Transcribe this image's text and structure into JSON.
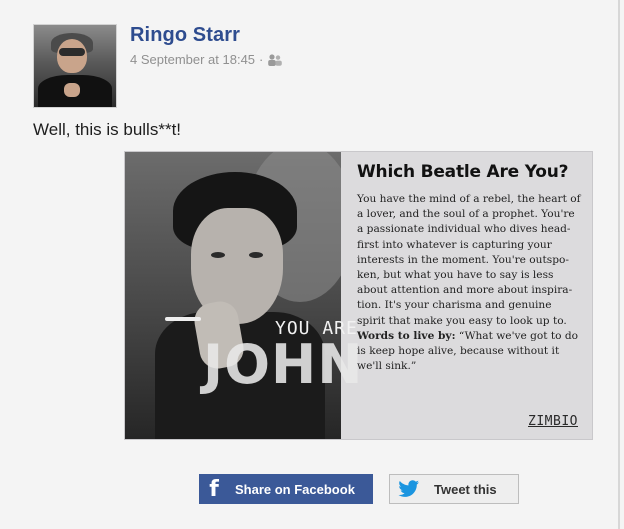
{
  "post": {
    "author": "Ringo Starr",
    "timestamp": "4 September at 18:45",
    "separator": "·",
    "audience_icon": "friends-icon",
    "text": "Well, this is bulls**t!"
  },
  "card": {
    "overlay_you_are": "YOU ARE",
    "overlay_name": "JOHN",
    "title": "Which Beatle Are You?",
    "body": "You have the mind of a rebel, the heart of a lover, and the soul of a prophet. You're a passionate individual who dives head-first into whatever is capturing your interests in the moment. You're outspo-ken, but what you have to say is less about attention and more about inspira-tion. It's your charisma and genuine spirit that make you easy to look up to.",
    "words_label": "Words to live by:",
    "words_quote": "“What we've got to do is keep hope alive, because without it we'll sink.”",
    "brand": "ZIMBIO"
  },
  "share": {
    "facebook_label": "Share on Facebook",
    "facebook_icon": "facebook-icon",
    "facebook_color": "#3b5998",
    "twitter_label": "Tweet this",
    "twitter_icon": "twitter-bird-icon",
    "twitter_color": "#1b95e0"
  },
  "colors": {
    "author_link": "#2e4c8f",
    "meta_gray": "#909090"
  }
}
